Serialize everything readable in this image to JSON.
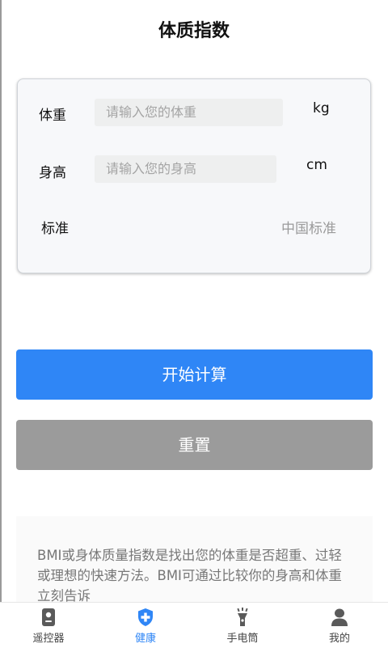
{
  "header": {
    "title": "体质指数"
  },
  "form": {
    "weight": {
      "label": "体重",
      "placeholder": "请输入您的体重",
      "unit": "kg"
    },
    "height": {
      "label": "身高",
      "placeholder": "请输入您的身高",
      "unit": "cm"
    },
    "standard": {
      "label": "标准",
      "value": "中国标准"
    }
  },
  "actions": {
    "calculate_label": "开始计算",
    "reset_label": "重置"
  },
  "info": {
    "text": "BMI或身体质量指数是找出您的体重是否超重、过轻或理想的快速方法。BMI可通过比较你的身高和体重立刻告诉"
  },
  "tabbar": {
    "active_color": "#2f86f6",
    "items": [
      {
        "label": "遥控器",
        "icon": "remote-icon"
      },
      {
        "label": "健康",
        "icon": "health-shield-icon"
      },
      {
        "label": "手电筒",
        "icon": "flashlight-icon"
      },
      {
        "label": "我的",
        "icon": "user-icon"
      }
    ]
  }
}
